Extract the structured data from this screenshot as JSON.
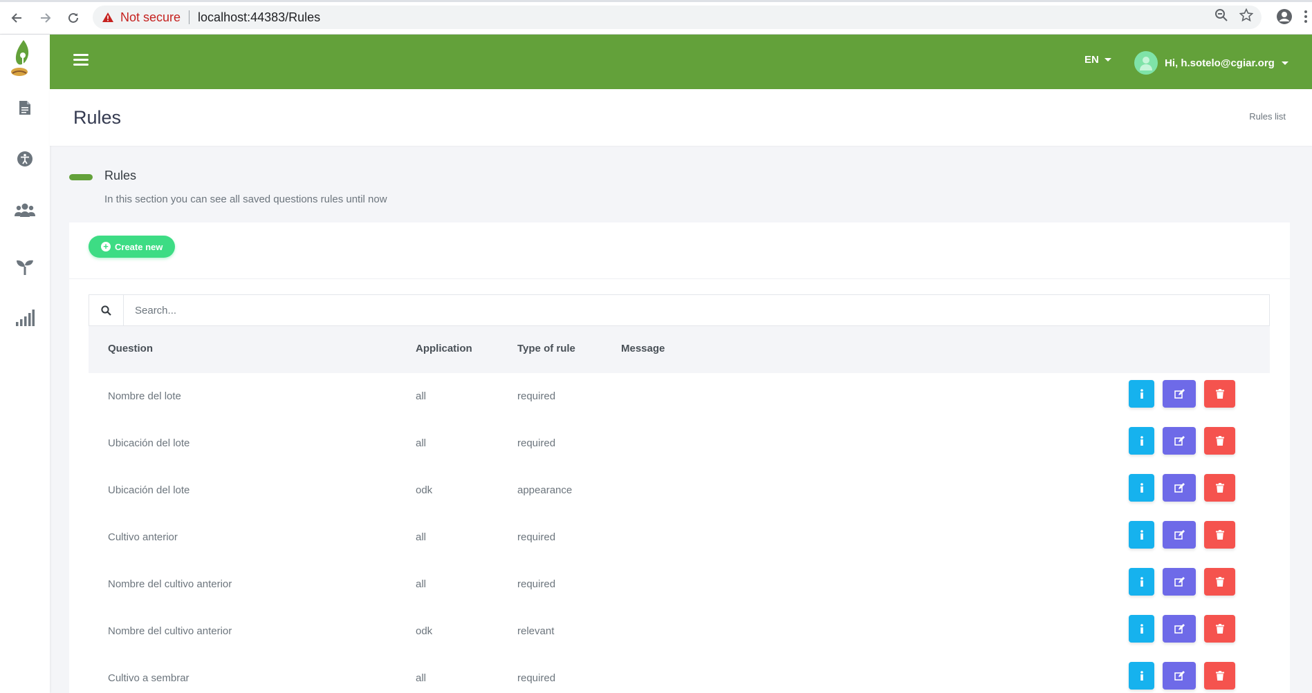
{
  "browser": {
    "security_label": "Not secure",
    "url": "localhost:44383/Rules"
  },
  "header": {
    "language": "EN",
    "user_greeting": "Hi, h.sotelo@cgiar.org"
  },
  "page": {
    "title": "Rules",
    "breadcrumb": "Rules list"
  },
  "section": {
    "title": "Rules",
    "description": "In this section you can see all saved questions rules until now"
  },
  "toolbar": {
    "create_label": "Create new"
  },
  "search": {
    "placeholder": "Search..."
  },
  "table": {
    "headers": [
      "Question",
      "Application",
      "Type of rule",
      "Message"
    ],
    "rows": [
      {
        "question": "Nombre del lote",
        "application": "all",
        "type": "required",
        "message": ""
      },
      {
        "question": "Ubicación del lote",
        "application": "all",
        "type": "required",
        "message": ""
      },
      {
        "question": "Ubicación del lote",
        "application": "odk",
        "type": "appearance",
        "message": ""
      },
      {
        "question": "Cultivo anterior",
        "application": "all",
        "type": "required",
        "message": ""
      },
      {
        "question": "Nombre del cultivo anterior",
        "application": "all",
        "type": "required",
        "message": ""
      },
      {
        "question": "Nombre del cultivo anterior",
        "application": "odk",
        "type": "relevant",
        "message": ""
      },
      {
        "question": "Cultivo a sembrar",
        "application": "all",
        "type": "required",
        "message": ""
      }
    ]
  },
  "colors": {
    "brand_green": "#63a13a",
    "create_button": "#3ddc84",
    "info_button": "#16b2ee",
    "edit_button": "#6e6ae8",
    "delete_button": "#f5534e"
  },
  "icons": {
    "sidebar": [
      "document-icon",
      "accessibility-icon",
      "users-icon",
      "seedling-icon",
      "signal-bars-icon"
    ],
    "row_actions": [
      "info-icon",
      "edit-icon",
      "trash-icon"
    ]
  }
}
